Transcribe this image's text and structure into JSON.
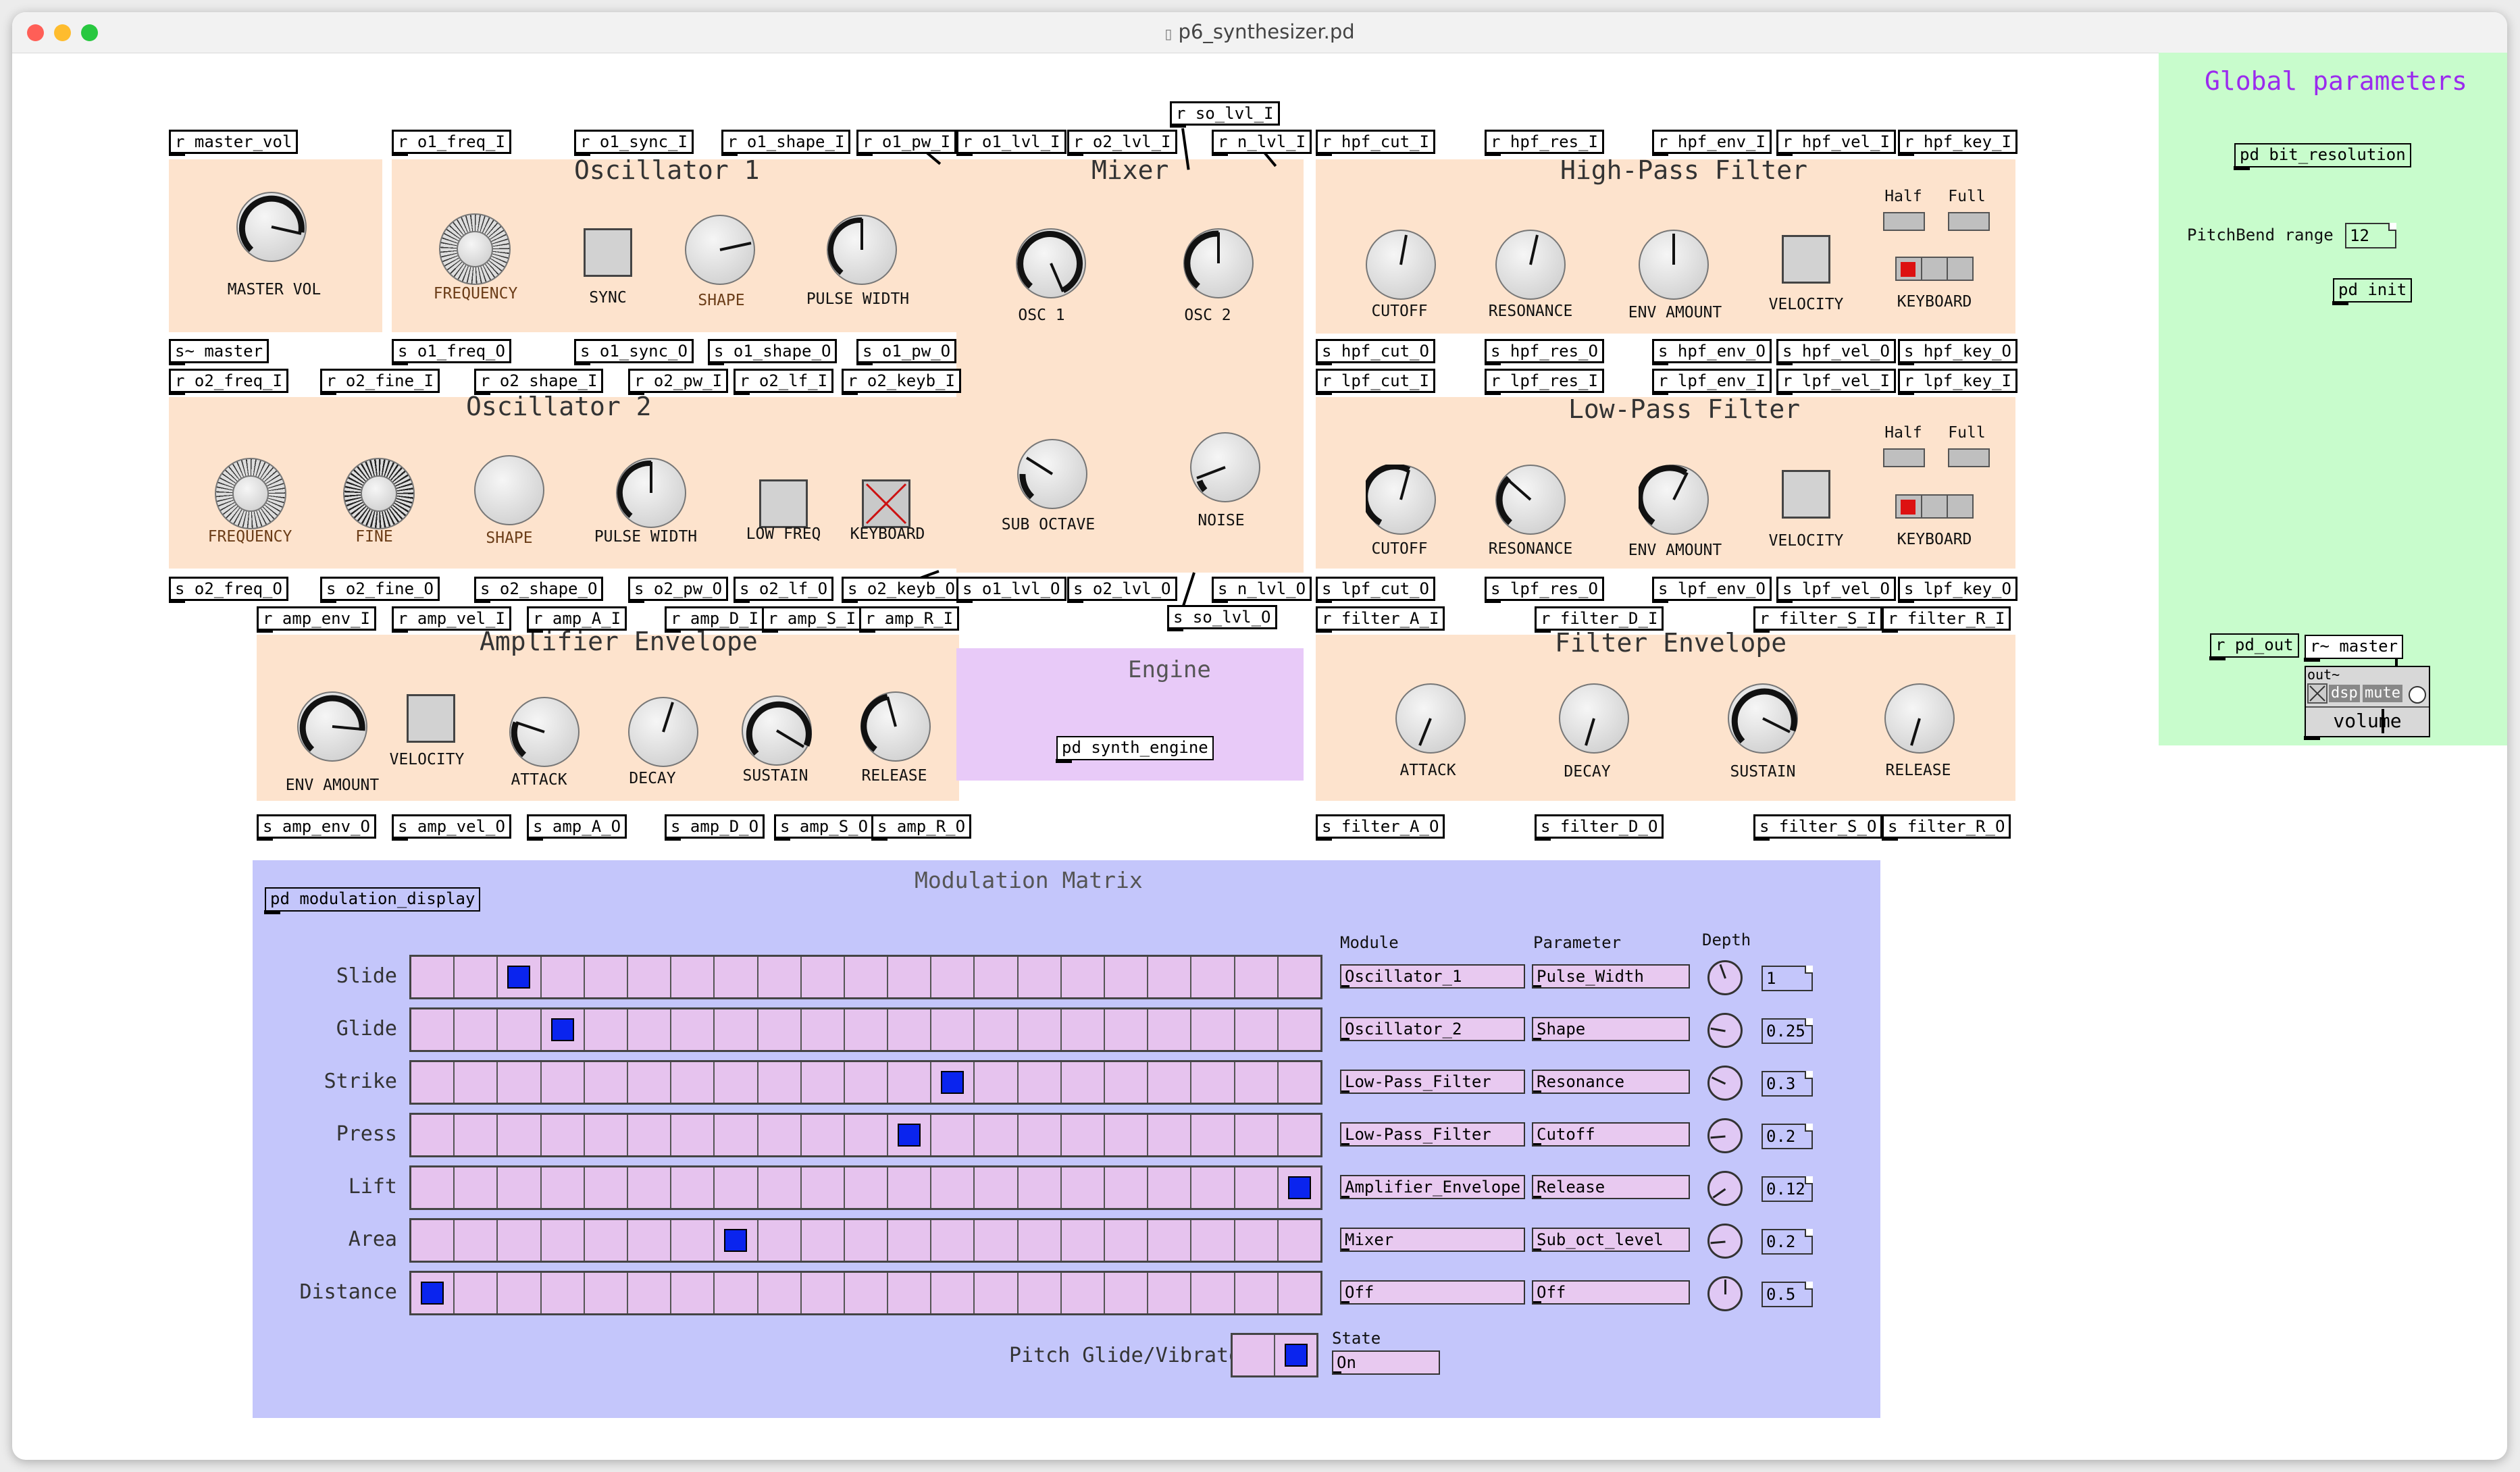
{
  "window": {
    "title": "p6_synthesizer.pd",
    "close_color": "#ff5f57",
    "min_color": "#febc2e",
    "max_color": "#28c840"
  },
  "colors": {
    "panel_bg": "#fde3cd",
    "engine_bg": "#e8caf8",
    "global_bg": "#c8fccc",
    "matrix_bg": "#c4c6fb",
    "global_title": "#9b2bee",
    "selected_cell": "#0a24ee",
    "keyboard_red": "#dd1111"
  },
  "boxes": {
    "r_master_vol": "r master_vol",
    "s_master": "s~ master",
    "r_o1_freq_I": "r o1_freq_I",
    "r_o1_sync_I": "r o1_sync_I",
    "r_o1_shape_I": "r o1_shape_I",
    "r_o1_pw_I": "r o1_pw_I",
    "s_o1_freq_O": "s o1_freq_O",
    "s_o1_sync_O": "s o1_sync_O",
    "s_o1_shape_O": "s o1_shape_O",
    "s_o1_pw_O": "s o1_pw_O",
    "r_o2_freq_I": "r o2_freq_I",
    "r_o2_fine_I": "r o2_fine_I",
    "r_o2_shape_I": "r o2 shape_I",
    "r_o2_pw_I": "r o2_pw_I",
    "r_o2_lf_I": "r o2_lf_I",
    "r_o2_keyb_I": "r o2_keyb_I",
    "s_o2_freq_O": "s o2_freq_O",
    "s_o2_fine_O": "s o2_fine_O",
    "s_o2_shape_O": "s o2_shape_O",
    "s_o2_pw_O": "s o2_pw_O",
    "s_o2_lf_O": "s o2_lf_O",
    "s_o2_keyb_O": "s o2_keyb_O",
    "r_so_lvl_I": "r so_lvl_I",
    "r_o1_lvl_I": "r o1_lvl_I",
    "r_o2_lvl_I": "r o2_lvl_I",
    "r_n_lvl_I": "r n_lvl_I",
    "s_o1_lvl_O": "s o1_lvl_O",
    "s_o2_lvl_O": "s o2_lvl_O",
    "s_n_lvl_O": "s n_lvl_O",
    "s_so_lvl_O": "s so_lvl_O",
    "r_hpf_cut_I": "r hpf_cut_I",
    "r_hpf_res_I": "r hpf_res_I",
    "r_hpf_env_I": "r hpf_env_I",
    "r_hpf_vel_I": "r hpf_vel_I",
    "r_hpf_key_I": "r hpf_key_I",
    "s_hpf_cut_O": "s hpf_cut_O",
    "s_hpf_res_O": "s hpf_res_O",
    "s_hpf_env_O": "s hpf_env_O",
    "s_hpf_vel_O": "s hpf_vel_O",
    "s_hpf_key_O": "s hpf_key_O",
    "r_lpf_cut_I": "r lpf_cut_I",
    "r_lpf_res_I": "r lpf_res_I",
    "r_lpf_env_I": "r lpf_env_I",
    "r_lpf_vel_I": "r lpf_vel_I",
    "r_lpf_key_I": "r lpf_key_I",
    "s_lpf_cut_O": "s lpf_cut_O",
    "s_lpf_res_O": "s lpf_res_O",
    "s_lpf_env_O": "s lpf_env_O",
    "s_lpf_vel_O": "s lpf_vel_O",
    "s_lpf_key_O": "s lpf_key_O",
    "r_amp_env_I": "r amp_env_I",
    "r_amp_vel_I": "r amp_vel_I",
    "r_amp_A_I": "r amp_A_I",
    "r_amp_D_I": "r amp_D_I",
    "r_amp_S_I": "r amp_S_I",
    "r_amp_R_I": "r amp_R_I",
    "s_amp_env_O": "s amp_env_O",
    "s_amp_vel_O": "s amp_vel_O",
    "s_amp_A_O": "s amp_A_O",
    "s_amp_D_O": "s amp_D_O",
    "s_amp_S_O": "s amp_S_O",
    "s_amp_R_O": "s amp_R_O",
    "r_filter_A_I": "r filter_A_I",
    "r_filter_D_I": "r filter_D_I",
    "r_filter_S_I": "r filter_S_I",
    "r_filter_R_I": "r filter_R_I",
    "s_filter_A_O": "s filter_A_O",
    "s_filter_D_O": "s filter_D_O",
    "s_filter_S_O": "s filter_S_O",
    "s_filter_R_O": "s filter_R_O",
    "pd_synth_engine": "pd synth_engine",
    "pd_modulation_display": "pd modulation_display",
    "pd_bit_resolution": "pd bit_resolution",
    "pd_init": "pd init",
    "r_pd_out": "r pd_out",
    "r_master": "r~ master"
  },
  "master": {
    "master_vol": "MASTER VOL"
  },
  "osc1": {
    "title": "Oscillator 1",
    "frequency": "FREQUENCY",
    "sync": "SYNC",
    "shape": "SHAPE",
    "pulse_width": "PULSE WIDTH"
  },
  "osc2": {
    "title": "Oscillator 2",
    "frequency": "FREQUENCY",
    "fine": "FINE",
    "shape": "SHAPE",
    "pulse_width": "PULSE WIDTH",
    "low_freq": "LOW FREQ",
    "keyboard": "KEYBOARD"
  },
  "mixer": {
    "title": "Mixer",
    "osc1": "OSC 1",
    "osc2": "OSC 2",
    "sub_octave": "SUB OCTAVE",
    "noise": "NOISE"
  },
  "hpf": {
    "title": "High-Pass Filter",
    "cutoff": "CUTOFF",
    "resonance": "RESONANCE",
    "env_amount": "ENV AMOUNT",
    "velocity": "VELOCITY",
    "keyboard": "KEYBOARD",
    "half": "Half",
    "full": "Full"
  },
  "lpf": {
    "title": "Low-Pass Filter",
    "cutoff": "CUTOFF",
    "resonance": "RESONANCE",
    "env_amount": "ENV AMOUNT",
    "velocity": "VELOCITY",
    "keyboard": "KEYBOARD",
    "half": "Half",
    "full": "Full"
  },
  "amp_env": {
    "title": "Amplifier Envelope",
    "env_amount": "ENV AMOUNT",
    "velocity": "VELOCITY",
    "attack": "ATTACK",
    "decay": "DECAY",
    "sustain": "SUSTAIN",
    "release": "RELEASE"
  },
  "engine": {
    "title": "Engine"
  },
  "filter_env": {
    "title": "Filter Envelope",
    "attack": "ATTACK",
    "decay": "DECAY",
    "sustain": "SUSTAIN",
    "release": "RELEASE"
  },
  "global": {
    "title": "Global parameters",
    "pitchbend_label": "PitchBend range",
    "pitchbend_value": "12",
    "out_label": "out~",
    "dsp_label": "dsp",
    "mute_label": "mute",
    "volume_label": "volume"
  },
  "matrix": {
    "title": "Modulation Matrix",
    "col_module": "Module",
    "col_parameter": "Parameter",
    "col_depth": "Depth",
    "columns": 21,
    "rows": [
      {
        "label": "Slide",
        "selected": 2,
        "module": "Oscillator_1",
        "parameter": "Pulse_Width",
        "depth": "1",
        "knob_angle": -20
      },
      {
        "label": "Glide",
        "selected": 3,
        "module": "Oscillator_2",
        "parameter": "Shape",
        "depth": "0.25",
        "knob_angle": -80
      },
      {
        "label": "Strike",
        "selected": 12,
        "module": "Low-Pass_Filter",
        "parameter": "Resonance",
        "depth": "0.3",
        "knob_angle": -65
      },
      {
        "label": "Press",
        "selected": 11,
        "module": "Low-Pass_Filter",
        "parameter": "Cutoff",
        "depth": "0.2",
        "knob_angle": -95
      },
      {
        "label": "Lift",
        "selected": 20,
        "module": "Amplifier_Envelope",
        "parameter": "Release",
        "depth": "0.12",
        "knob_angle": -125
      },
      {
        "label": "Area",
        "selected": 7,
        "module": "Mixer",
        "parameter": "Sub_oct_level",
        "depth": "0.2",
        "knob_angle": -95
      },
      {
        "label": "Distance",
        "selected": 0,
        "module": "Off",
        "parameter": "Off",
        "depth": "0.5",
        "knob_angle": 0
      }
    ],
    "pitch_glide_label": "Pitch Glide/Vibrato",
    "state_label": "State",
    "state_value": "On"
  }
}
